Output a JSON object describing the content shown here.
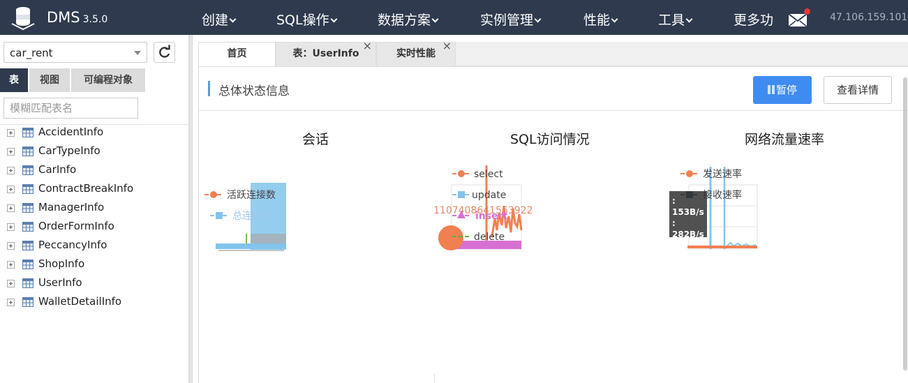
{
  "app": {
    "name": "DMS",
    "version": "3.5.0",
    "ip": "47.106.159.101"
  },
  "nav": [
    {
      "label": "创建"
    },
    {
      "label": "SQL操作"
    },
    {
      "label": "数据方案"
    },
    {
      "label": "实例管理"
    },
    {
      "label": "性能"
    },
    {
      "label": "工具"
    },
    {
      "label": "更多功"
    }
  ],
  "sidebar": {
    "database": "car_rent",
    "tabs": [
      {
        "label": "表"
      },
      {
        "label": "视图"
      },
      {
        "label": "可编程对象"
      }
    ],
    "filter_placeholder": "模糊匹配表名",
    "tables": [
      "AccidentInfo",
      "CarTypeInfo",
      "CarInfo",
      "ContractBreakInfo",
      "ManagerInfo",
      "OrderFormInfo",
      "PeccancyInfo",
      "ShopInfo",
      "UserInfo",
      "WalletDetailInfo"
    ]
  },
  "tabs": [
    {
      "label": "首页"
    },
    {
      "label": "表：UserInfo"
    },
    {
      "label": "实时性能"
    }
  ],
  "main": {
    "section_title": "总体状态信息",
    "pause_label": "暂停",
    "detail_label": "查看详情",
    "panels": [
      {
        "title": "会话"
      },
      {
        "title": "SQL访问情况"
      },
      {
        "title": "网络流量速率"
      }
    ],
    "tooltip": {
      "line1": ": 153B/s",
      "line2": ": 282B/s"
    },
    "overflow_text": "1107408641563922"
  },
  "chart_data": [
    {
      "type": "line",
      "title": "会话",
      "series": [
        {
          "name": "活跃连接数",
          "color": "#f27f51"
        },
        {
          "name": "总连接数",
          "color": "#82c4ec"
        }
      ]
    },
    {
      "type": "line",
      "title": "SQL访问情况",
      "series": [
        {
          "name": "select",
          "color": "#f27f51"
        },
        {
          "name": "update",
          "color": "#82c4ec"
        },
        {
          "name": "insert",
          "color": "#d770d2"
        },
        {
          "name": "delete",
          "color": "#5ab53c"
        }
      ]
    },
    {
      "type": "line",
      "title": "网络流量速率",
      "series": [
        {
          "name": "发送速率",
          "color": "#f27f51"
        },
        {
          "name": "接收速率",
          "color": "#2f5a8a"
        }
      ]
    }
  ]
}
